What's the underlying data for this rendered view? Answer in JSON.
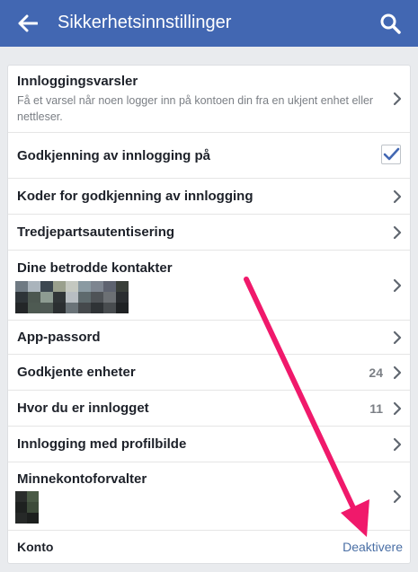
{
  "header": {
    "title": "Sikkerhetsinnstillinger",
    "back_icon": "arrow-left-icon",
    "search_icon": "search-icon",
    "bar_color": "#4267b2"
  },
  "settings": {
    "login_alerts": {
      "title": "Innloggingsvarsler",
      "subtitle": "Få et varsel når noen logger inn på kontoen din fra en ukjent enhet eller nettleser."
    },
    "login_approvals": {
      "title": "Godkjenning av innlogging på",
      "checked": true
    },
    "approval_codes": {
      "title": "Koder for godkjenning av innlogging"
    },
    "third_party_auth": {
      "title": "Tredjepartsautentisering"
    },
    "trusted_contacts": {
      "title": "Dine betrodde kontakter",
      "thumbnail_colors": [
        "#6f7a83",
        "#aab4bc",
        "#3c4750",
        "#9aa08d",
        "#c4c8c0",
        "#8a9aa2",
        "#7d8590",
        "#5e6370",
        "#3a3f3a",
        "#2e3438",
        "#4c5750",
        "#8e9c92",
        "#313638",
        "#b8bec2",
        "#5e6a6d",
        "#4f5357",
        "#6c7074",
        "#2a2d30",
        "#232628",
        "#4e5a52",
        "#505a55",
        "#2b2f31",
        "#6a7378",
        "#45494c",
        "#2f3336",
        "#484c4f",
        "#1f2224"
      ]
    },
    "app_passwords": {
      "title": "App-passord"
    },
    "recognized_devices": {
      "title": "Godkjente enheter",
      "count": "24"
    },
    "where_logged_in": {
      "title": "Hvor du er innlogget",
      "count": "11"
    },
    "profile_picture_login": {
      "title": "Innlogging med profilbilde"
    },
    "memorial_contact": {
      "title": "Minnekontoforvalter",
      "thumbnail_colors": [
        "#2a2d2c",
        "#4a5a46",
        "#1e2120",
        "#3d4b3a",
        "#262928",
        "#1c1f1e"
      ]
    },
    "account": {
      "title": "Konto",
      "action": "Deaktivere"
    }
  },
  "annotation": {
    "arrow_color": "#f0196b"
  },
  "colors": {
    "chevron": "#606770",
    "checkmark": "#4267b2",
    "link": "#4a6fa5"
  }
}
